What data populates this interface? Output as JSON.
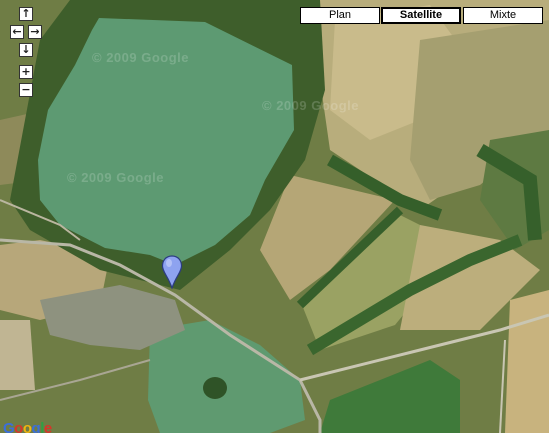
{
  "map": {
    "type_buttons": {
      "plan": "Plan",
      "satellite": "Satellite",
      "mixte": "Mixte"
    },
    "active_type": "Satellite",
    "watermark": "© 2009 Google",
    "logo": "Google",
    "nav": {
      "up": "↑",
      "left": "←",
      "right": "→",
      "down": "↓",
      "zoom_in": "+",
      "zoom_out": "−"
    }
  }
}
